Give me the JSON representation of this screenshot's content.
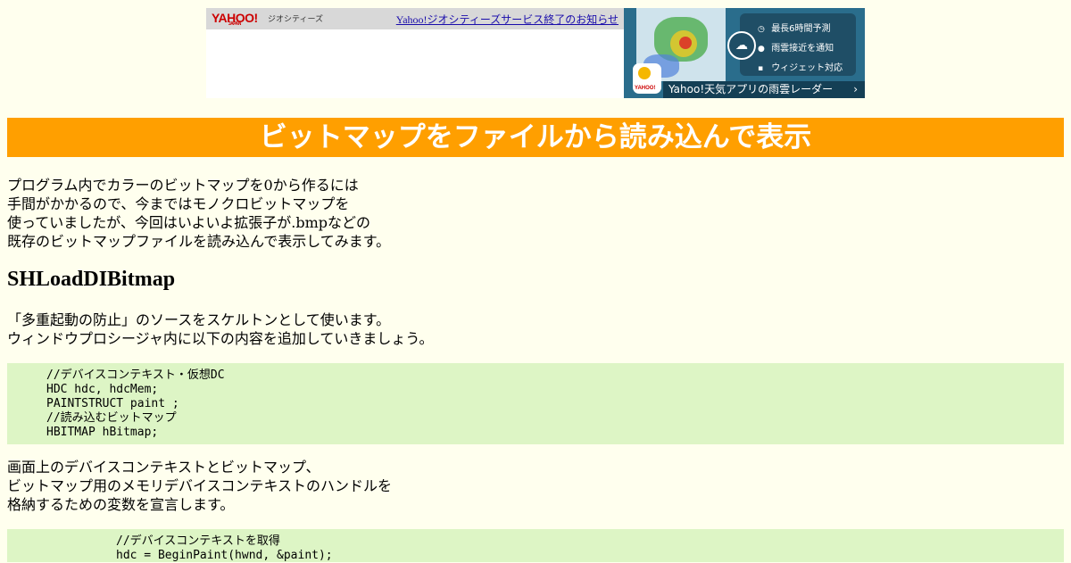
{
  "ad": {
    "brand": "YAHOO!",
    "brand_sub": "JAPAN",
    "service": "ジオシティーズ",
    "notice_link": "Yahoo!ジオシティーズサービス終了のお知らせ",
    "features": [
      "最長6時間予測",
      "雨雲接近を通知",
      "ウィジェット対応"
    ],
    "app_brand": "YAHOO!",
    "cta": "Yahoo!天気アプリの雨雲レーダー",
    "cta_chevron": "›",
    "colors": {
      "ad_bg": "#2a6d8c",
      "ad_panel": "#1f4e66",
      "brand_red": "#cc0000"
    }
  },
  "page": {
    "title": "ビットマップをファイルから読み込んで表示",
    "intro": [
      "プログラム内でカラーのビットマップを0から作るには",
      "手間がかかるので、今まではモノクロビットマップを",
      "使っていましたが、今回はいよいよ拡張子が.bmpなどの",
      "既存のビットマップファイルを読み込んで表示してみます。"
    ],
    "section_heading": "SHLoadDIBitmap",
    "section_intro": [
      "「多重起動の防止」のソースをスケルトンとして使います。",
      "ウィンドウプロシージャ内に以下の内容を追加していきましょう。"
    ],
    "code1": [
      "//デバイスコンテキスト・仮想DC",
      "HDC hdc, hdcMem;",
      "PAINTSTRUCT paint ;",
      "//読み込むビットマップ",
      "HBITMAP hBitmap;"
    ],
    "explain1": [
      "画面上のデバイスコンテキストとビットマップ、",
      "ビットマップ用のメモリデバイスコンテキストのハンドルを",
      "格納するための変数を宣言します。"
    ],
    "code2": [
      "//デバイスコンテキストを取得",
      "hdc = BeginPaint(hwnd, &paint);"
    ],
    "colors": {
      "background": "#ffffee",
      "title_bar": "#ff9f00",
      "code_bg": "#ddf5c5"
    }
  }
}
